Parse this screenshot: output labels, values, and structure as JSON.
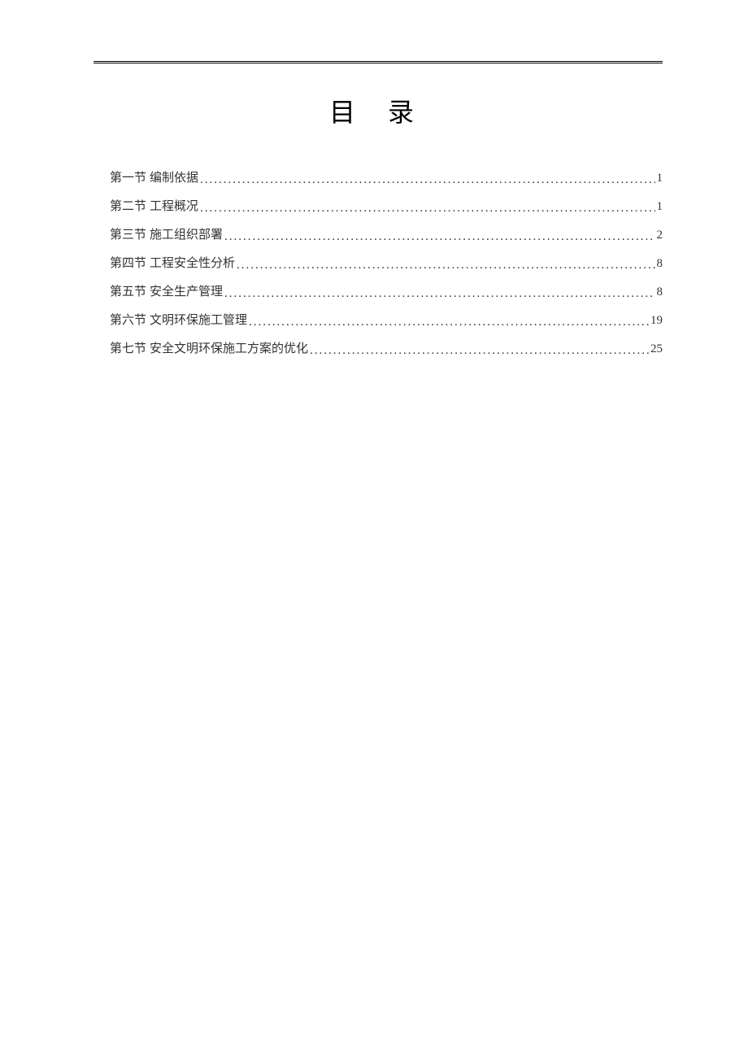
{
  "title": "目 录",
  "toc": [
    {
      "section": "第一节",
      "title": "编制依据",
      "page": "1"
    },
    {
      "section": "第二节",
      "title": "工程概况",
      "page": "1"
    },
    {
      "section": "第三节",
      "title": "施工组织部署",
      "page": "2"
    },
    {
      "section": "第四节",
      "title": "工程安全性分析",
      "page": "8"
    },
    {
      "section": "第五节",
      "title": "安全生产管理",
      "page": "8"
    },
    {
      "section": "第六节",
      "title": "文明环保施工管理",
      "page": "19"
    },
    {
      "section": "第七节",
      "title": "安全文明环保施工方案的优化",
      "page": "25"
    }
  ]
}
